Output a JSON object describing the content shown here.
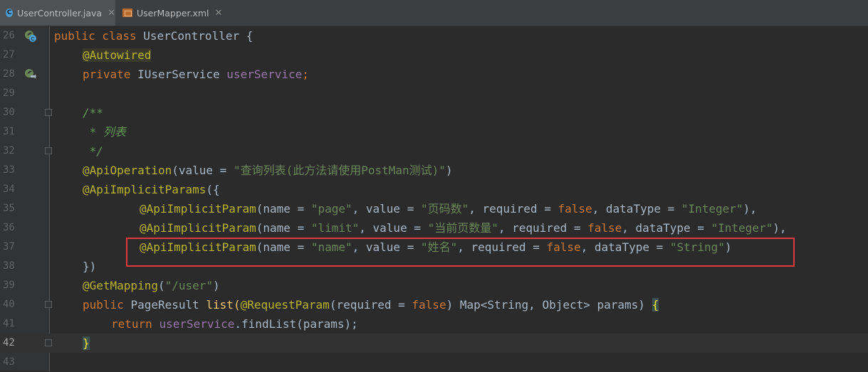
{
  "tabs": [
    {
      "label": "UserController.java",
      "icon": "java-class-icon",
      "close": "✕",
      "active": true
    },
    {
      "label": "UserMapper.xml",
      "icon": "xml-file-icon",
      "close": "✕",
      "active": false
    }
  ],
  "editor": {
    "current_line": "42",
    "lines": [
      {
        "n": "26"
      },
      {
        "n": "27"
      },
      {
        "n": "28"
      },
      {
        "n": "29"
      },
      {
        "n": "30"
      },
      {
        "n": "31"
      },
      {
        "n": "32"
      },
      {
        "n": "33"
      },
      {
        "n": "34"
      },
      {
        "n": "35"
      },
      {
        "n": "36"
      },
      {
        "n": "37"
      },
      {
        "n": "38"
      },
      {
        "n": "39"
      },
      {
        "n": "40"
      },
      {
        "n": "41"
      },
      {
        "n": "42"
      },
      {
        "n": "43"
      }
    ],
    "tokens": {
      "l26": {
        "a": "public class ",
        "b": "UserController {"
      },
      "l27": {
        "a": "@Autowired"
      },
      "l28": {
        "a": "private ",
        "b": "IUserService ",
        "c": "userService",
        "d": ";"
      },
      "l30": {
        "a": "/**"
      },
      "l31": {
        "a": " * 列表"
      },
      "l32": {
        "a": " */"
      },
      "l33": {
        "a": "@ApiOperation",
        "b": "(value = ",
        "c": "\"查询列表(此方法请使用PostMan测试)\"",
        "d": ")"
      },
      "l34": {
        "a": "@ApiImplicitParams",
        "b": "({"
      },
      "l35": {
        "a": "@ApiImplicitParam",
        "b": "(name = ",
        "c": "\"page\"",
        "d": ", value = ",
        "e": "\"页码数\"",
        "f": ", required = ",
        "g": "false",
        "h": ", dataType = ",
        "i": "\"Integer\"",
        "j": "),"
      },
      "l36": {
        "a": "@ApiImplicitParam",
        "b": "(name = ",
        "c": "\"limit\"",
        "d": ", value = ",
        "e": "\"当前页数量\"",
        "f": ", required = ",
        "g": "false",
        "h": ", dataType = ",
        "i": "\"Integer\"",
        "j": "),"
      },
      "l37": {
        "a": "@ApiImplicitParam",
        "b": "(name = ",
        "c": "\"name\"",
        "d": ", value = ",
        "e": "\"姓名\"",
        "f": ", required = ",
        "g": "false",
        "h": ", dataType = ",
        "i": "\"String\"",
        "j": ")"
      },
      "l38": {
        "a": "})"
      },
      "l39": {
        "a": "@GetMapping",
        "b": "(",
        "c": "\"/user\"",
        "d": ")"
      },
      "l40": {
        "a": "public ",
        "b": "PageResult ",
        "c": "list(",
        "d": "@RequestParam",
        "e": "(required = ",
        "f": "false",
        "g": ") Map<String, Object> params) ",
        "h": "{"
      },
      "l41": {
        "a": "return ",
        "b": "userService",
        "c": ".findList(params);"
      },
      "l42": {
        "a": "}"
      }
    }
  },
  "colors": {
    "background": "#2b2b2b",
    "keyword": "#cc7832",
    "annotation": "#bbb529",
    "string": "#6a8759",
    "field": "#9876aa",
    "highlight_box": "#e0393e"
  }
}
